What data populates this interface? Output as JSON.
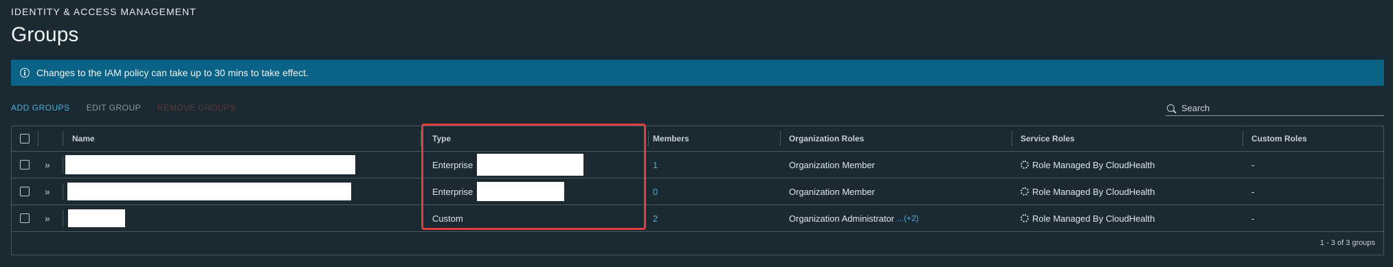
{
  "header": {
    "eyebrow": "IDENTITY & ACCESS MANAGEMENT",
    "title": "Groups"
  },
  "alert": {
    "icon": "info-icon",
    "message": "Changes to the IAM policy can take up to 30 mins to take effect."
  },
  "toolbar": {
    "add_label": "ADD GROUPS",
    "edit_label": "EDIT GROUP",
    "remove_label": "REMOVE GROUPS"
  },
  "search": {
    "placeholder": "Search",
    "value": ""
  },
  "table": {
    "columns": [
      "Name",
      "Type",
      "Members",
      "Organization Roles",
      "Service Roles",
      "Custom Roles"
    ],
    "rows": [
      {
        "name": "",
        "type": "Enterprise",
        "members": "1",
        "org_role": "Organization Member",
        "org_role_more": "",
        "service_role": "Role Managed By CloudHealth",
        "custom_role": "-"
      },
      {
        "name": "",
        "type": "Enterprise",
        "members": "0",
        "org_role": "Organization Member",
        "org_role_more": "",
        "service_role": "Role Managed By CloudHealth",
        "custom_role": "-"
      },
      {
        "name": "",
        "type": "Custom",
        "members": "2",
        "org_role": "Organization Administrator",
        "org_role_more": "...(+2)",
        "service_role": "Role Managed By CloudHealth",
        "custom_role": "-"
      }
    ],
    "footer": "1 - 3 of 3 groups"
  },
  "colors": {
    "background": "#1b2a32",
    "alert": "#0a6287",
    "link": "#49afd9",
    "highlight": "#e0403c"
  }
}
